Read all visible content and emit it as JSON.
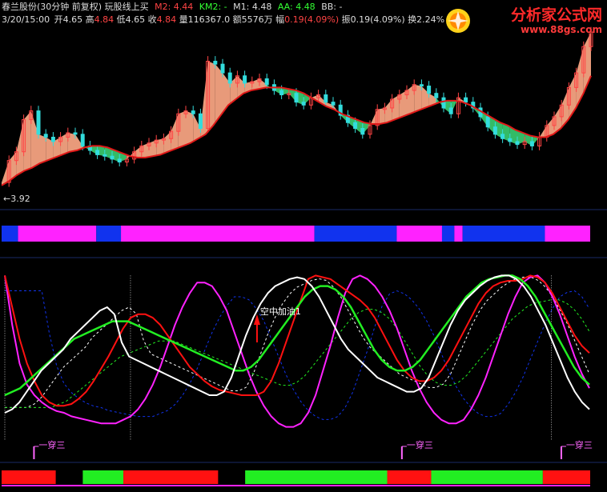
{
  "header": {
    "stock_name": "春兰股份(30分钟 前复权)",
    "indicator_name": "玩股线上买",
    "m2_label": "M2: 4.44",
    "km2_label": "KM2: -",
    "m1_label": "M1: 4.48",
    "aa_label": "AA: 4.48",
    "bb_label": "BB: -",
    "datetime": "3/20/15:00",
    "open_label": "开",
    "open_value": "4.65",
    "high_label": "高",
    "high_value": "4.84",
    "low_label": "低",
    "low_value": "4.65",
    "close_label": "收",
    "close_value": "4.84",
    "volume_label": "量",
    "volume_value": "116367.0",
    "amount_label": "额",
    "amount_value": "5576万",
    "change_label": "幅",
    "change_value": "0.19(4.09%)",
    "amplitude_label": "振",
    "amplitude_value": "0.19(4.09%)",
    "turnover_label": "换",
    "turnover_value": "2.24%"
  },
  "watermark": {
    "site_name": "分析家公式网",
    "url": "www.88gs.com"
  },
  "colors": {
    "background": "#000000",
    "panel_divider": "#1a2a66",
    "candle_up": "#ff4444",
    "candle_down": "#33dddd",
    "ribbon_up": "#e89a7a",
    "ribbon_down": "#33bb66",
    "base_line": "#e01818",
    "magenta": "#ff22ff",
    "blue": "#1133ee",
    "red": "#ff1111",
    "green": "#22ee22",
    "white": "#ffffff",
    "label_magenta": "#ff66ff"
  },
  "chart_data": [
    {
      "type": "line",
      "panel": "price",
      "low_marker": "←3.92",
      "ylim": [
        3.85,
        5.0
      ],
      "base_line": [
        3.95,
        3.98,
        4.02,
        4.05,
        4.07,
        4.1,
        4.12,
        4.14,
        4.16,
        4.18,
        4.19,
        4.21,
        4.22,
        4.22,
        4.21,
        4.19,
        4.17,
        4.15,
        4.14,
        4.14,
        4.15,
        4.16,
        4.18,
        4.2,
        4.22,
        4.24,
        4.27,
        4.3,
        4.36,
        4.43,
        4.5,
        4.54,
        4.58,
        4.6,
        4.61,
        4.62,
        4.62,
        4.62,
        4.61,
        4.6,
        4.58,
        4.55,
        4.52,
        4.49,
        4.47,
        4.44,
        4.42,
        4.4,
        4.38,
        4.37,
        4.37,
        4.38,
        4.4,
        4.42,
        4.44,
        4.46,
        4.48,
        4.5,
        4.52,
        4.53,
        4.53,
        4.52,
        4.5,
        4.47,
        4.44,
        4.41,
        4.38,
        4.36,
        4.33,
        4.31,
        4.29,
        4.28,
        4.28,
        4.3,
        4.34,
        4.4,
        4.48,
        4.58,
        4.7
      ],
      "price_line": [
        3.97,
        4.12,
        4.18,
        4.4,
        4.46,
        4.3,
        4.28,
        4.25,
        4.28,
        4.31,
        4.3,
        4.22,
        4.19,
        4.16,
        4.15,
        4.13,
        4.11,
        4.13,
        4.18,
        4.22,
        4.24,
        4.26,
        4.27,
        4.32,
        4.44,
        4.46,
        4.44,
        4.34,
        4.8,
        4.78,
        4.72,
        4.65,
        4.7,
        4.65,
        4.66,
        4.68,
        4.64,
        4.6,
        4.57,
        4.58,
        4.52,
        4.5,
        4.55,
        4.57,
        4.52,
        4.5,
        4.43,
        4.38,
        4.34,
        4.3,
        4.36,
        4.47,
        4.48,
        4.54,
        4.57,
        4.6,
        4.64,
        4.63,
        4.58,
        4.55,
        4.48,
        4.44,
        4.55,
        4.52,
        4.48,
        4.42,
        4.35,
        4.3,
        4.27,
        4.25,
        4.23,
        4.25,
        4.22,
        4.28,
        4.36,
        4.42,
        4.5,
        4.62,
        4.72,
        4.9,
        5.0
      ]
    },
    {
      "type": "bar",
      "panel": "state-band-top",
      "segments": [
        {
          "from": 0,
          "to": 4,
          "color": "blue"
        },
        {
          "from": 4,
          "to": 23,
          "color": "magenta"
        },
        {
          "from": 23,
          "to": 29,
          "color": "blue"
        },
        {
          "from": 29,
          "to": 76,
          "color": "magenta"
        },
        {
          "from": 76,
          "to": 96,
          "color": "blue"
        },
        {
          "from": 96,
          "to": 107,
          "color": "magenta"
        },
        {
          "from": 107,
          "to": 110,
          "color": "blue"
        },
        {
          "from": 110,
          "to": 112,
          "color": "magenta"
        },
        {
          "from": 112,
          "to": 132,
          "color": "blue"
        },
        {
          "from": 132,
          "to": 143,
          "color": "magenta"
        }
      ]
    },
    {
      "type": "line",
      "panel": "oscillator",
      "ylim": [
        0,
        100
      ],
      "annotation": "空中加油1",
      "signal_label": "一穿三",
      "signal_positions": [
        4,
        94,
        133
      ],
      "fuel_position": 33,
      "red_series": [
        98,
        80,
        62,
        48,
        38,
        30,
        26,
        24,
        24,
        25,
        28,
        32,
        38,
        45,
        52,
        60,
        68,
        74,
        76,
        76,
        74,
        70,
        64,
        58,
        52,
        46,
        42,
        38,
        35,
        33,
        32,
        31,
        30,
        30,
        30,
        32,
        38,
        48,
        60,
        72,
        84,
        96,
        98,
        97,
        96,
        93,
        90,
        87,
        84,
        80,
        74,
        66,
        58,
        50,
        44,
        40,
        38,
        38,
        40,
        44,
        50,
        58,
        66,
        74,
        82,
        88,
        92,
        94,
        95,
        95,
        96,
        98,
        97,
        94,
        88,
        80,
        72,
        64,
        58,
        54
      ],
      "magenta_series": [
        98,
        70,
        48,
        36,
        30,
        26,
        23,
        21,
        20,
        18,
        17,
        16,
        15,
        14,
        14,
        14,
        16,
        18,
        22,
        28,
        36,
        46,
        58,
        70,
        80,
        88,
        94,
        94,
        92,
        86,
        78,
        66,
        54,
        42,
        32,
        24,
        18,
        14,
        12,
        12,
        14,
        20,
        30,
        44,
        58,
        74,
        88,
        96,
        98,
        96,
        92,
        86,
        78,
        68,
        56,
        44,
        34,
        26,
        20,
        16,
        14,
        14,
        16,
        22,
        30,
        40,
        52,
        64,
        76,
        86,
        94,
        97,
        98,
        94,
        86,
        76,
        64,
        52,
        42,
        34
      ],
      "white_series": [
        20,
        22,
        26,
        32,
        38,
        44,
        48,
        52,
        56,
        62,
        66,
        70,
        74,
        78,
        80,
        76,
        60,
        52,
        50,
        48,
        46,
        44,
        42,
        40,
        38,
        36,
        34,
        32,
        30,
        30,
        32,
        40,
        52,
        64,
        74,
        82,
        88,
        92,
        94,
        96,
        97,
        96,
        92,
        86,
        78,
        70,
        62,
        56,
        52,
        48,
        44,
        40,
        38,
        36,
        34,
        32,
        32,
        34,
        40,
        50,
        60,
        70,
        78,
        84,
        88,
        92,
        95,
        97,
        98,
        98,
        96,
        92,
        86,
        78,
        70,
        60,
        50,
        40,
        32,
        26,
        22
      ],
      "green_series": [
        30,
        32,
        34,
        38,
        42,
        46,
        50,
        54,
        58,
        62,
        64,
        66,
        68,
        70,
        72,
        72,
        72,
        70,
        68,
        66,
        64,
        62,
        60,
        58,
        56,
        54,
        52,
        50,
        48,
        46,
        44,
        44,
        46,
        50,
        56,
        62,
        68,
        74,
        80,
        86,
        90,
        92,
        92,
        90,
        86,
        80,
        72,
        64,
        56,
        50,
        46,
        44,
        44,
        46,
        50,
        56,
        62,
        68,
        74,
        80,
        86,
        90,
        94,
        96,
        97,
        98,
        98,
        96,
        92,
        86,
        78,
        70,
        62,
        54,
        46,
        40,
        36
      ]
    },
    {
      "type": "bar",
      "panel": "state-band-bottom",
      "segments": [
        {
          "from": 0,
          "to": 16,
          "color": "red"
        },
        {
          "from": 16,
          "to": 24,
          "color": "none"
        },
        {
          "from": 24,
          "to": 36,
          "color": "green"
        },
        {
          "from": 36,
          "to": 64,
          "color": "red"
        },
        {
          "from": 64,
          "to": 72,
          "color": "none"
        },
        {
          "from": 72,
          "to": 114,
          "color": "green"
        },
        {
          "from": 114,
          "to": 127,
          "color": "red"
        },
        {
          "from": 127,
          "to": 160,
          "color": "green"
        },
        {
          "from": 160,
          "to": 174,
          "color": "red"
        }
      ]
    }
  ]
}
